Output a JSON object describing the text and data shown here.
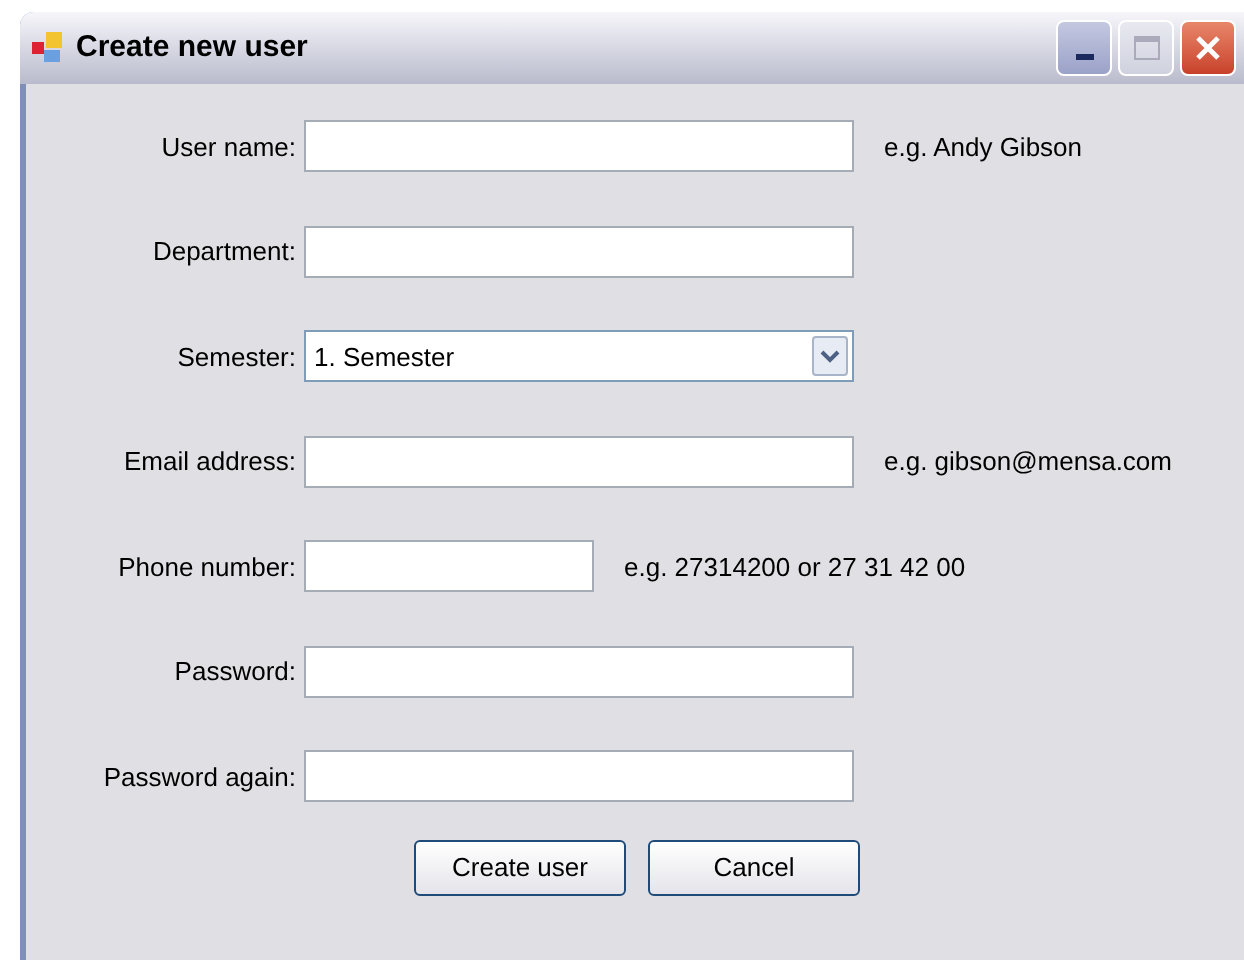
{
  "window": {
    "title": "Create new user"
  },
  "fields": [
    {
      "kind": "text",
      "label": "User name:",
      "hint": "e.g. Andy Gibson"
    },
    {
      "kind": "text",
      "label": "Department:"
    },
    {
      "kind": "combo",
      "label": "Semester:",
      "value": "1. Semester"
    },
    {
      "kind": "text",
      "label": "Email address:",
      "hint": "e.g. gibson@mensa.com"
    },
    {
      "kind": "short_text",
      "label": "Phone number:",
      "hint": "e.g. 27314200 or 27 31 42 00"
    },
    {
      "kind": "text",
      "label": "Password:"
    },
    {
      "kind": "text",
      "label": "Password again:"
    }
  ],
  "buttons": [
    "Create user",
    "Cancel"
  ]
}
